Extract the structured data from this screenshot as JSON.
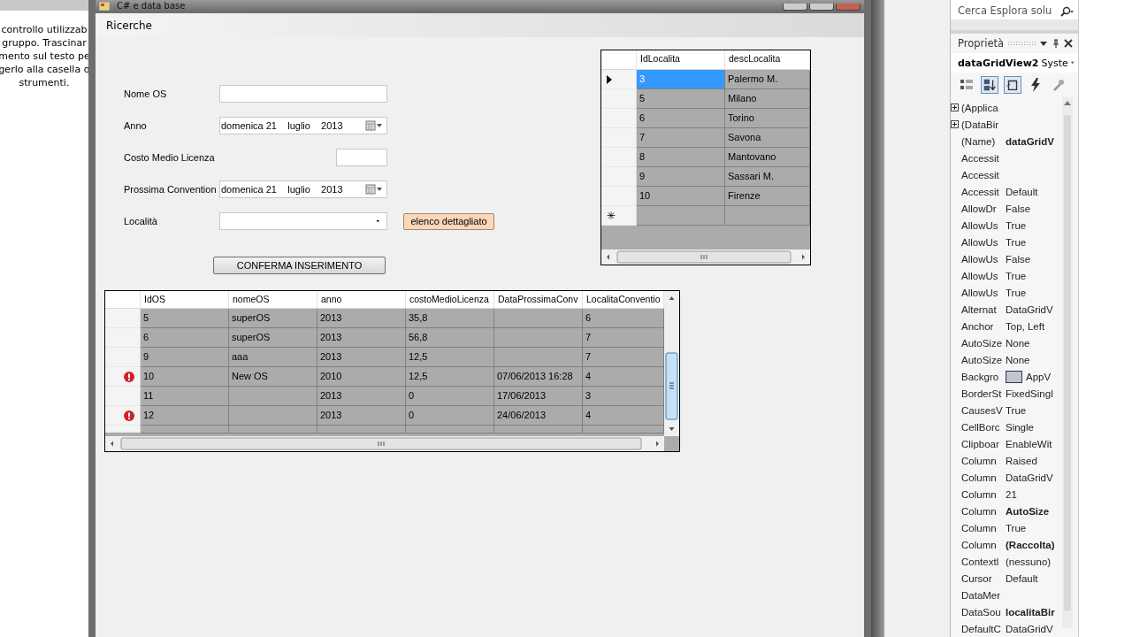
{
  "left_panel": {
    "lines": [
      "controllo utilizzab",
      "gruppo. Trascinar",
      "mento sul testo pe",
      "gerlo alla casella d",
      "strumenti."
    ]
  },
  "form_window": {
    "title": "C# e data base",
    "menu": [
      "Ricerche"
    ],
    "fields": [
      {
        "kind": "text",
        "label": "Nome OS"
      },
      {
        "kind": "date",
        "label": "Anno",
        "value": "domenica 21    luglio    2013"
      },
      {
        "kind": "short",
        "label": "Costo Medio Licenza"
      },
      {
        "kind": "date",
        "label": "Prossima Convention",
        "value": "domenica 21    luglio    2013"
      },
      {
        "kind": "combo",
        "label": "Località",
        "button": "elenco dettagliato"
      }
    ],
    "confirm_button": "CONFERMA INSERIMENTO",
    "localita_grid": {
      "columns": [
        "IdLocalita",
        "descLocalita"
      ],
      "rows": [
        {
          "selected": true,
          "cells": [
            "3",
            "Palermo M."
          ]
        },
        {
          "selected": false,
          "cells": [
            "5",
            "Milano"
          ]
        },
        {
          "selected": false,
          "cells": [
            "6",
            "Torino"
          ]
        },
        {
          "selected": false,
          "cells": [
            "7",
            "Savona"
          ]
        },
        {
          "selected": false,
          "cells": [
            "8",
            "Mantovano"
          ]
        },
        {
          "selected": false,
          "cells": [
            "9",
            "Sassari M."
          ]
        },
        {
          "selected": false,
          "cells": [
            "10",
            "Firenze"
          ]
        }
      ],
      "new_row_marker": "✳"
    },
    "os_grid": {
      "columns": [
        "IdOS",
        "nomeOS",
        "anno",
        "costoMedioLicenza",
        "DataProssimaConv",
        "LocalitaConventio"
      ],
      "rows": [
        {
          "error": false,
          "cells": [
            "5",
            "superOS",
            "2013",
            "35,8",
            "",
            "6"
          ]
        },
        {
          "error": false,
          "cells": [
            "6",
            "superOS",
            "2013",
            "56,8",
            "",
            "7"
          ]
        },
        {
          "error": false,
          "cells": [
            "9",
            "aaa",
            "2013",
            "12,5",
            "",
            "7"
          ]
        },
        {
          "error": true,
          "cells": [
            "10",
            "New OS",
            "2010",
            "12,5",
            "07/06/2013 16:28",
            "4"
          ]
        },
        {
          "error": false,
          "cells": [
            "11",
            "",
            "2013",
            "0",
            "17/06/2013",
            "3"
          ]
        },
        {
          "error": true,
          "cells": [
            "12",
            "",
            "2013",
            "0",
            "24/06/2013",
            "4"
          ]
        }
      ]
    }
  },
  "solution_search": {
    "placeholder": "Cerca Esplora solu"
  },
  "properties": {
    "title": "Proprietà",
    "object": "dataGridView2",
    "object_type": "Syste",
    "rows": [
      {
        "name": "(Applica",
        "expandable": true
      },
      {
        "name": "(DataBir",
        "expandable": true
      },
      {
        "name": "(Name)",
        "value": "dataGridV",
        "expandable": false,
        "bold": true
      },
      {
        "name": "Accessit",
        "expandable": false
      },
      {
        "name": "Accessit",
        "expandable": false
      },
      {
        "name": "Accessit",
        "value": "Default",
        "expandable": false,
        "bold": false
      },
      {
        "name": "AllowDr",
        "value": "False",
        "expandable": false,
        "bold": false
      },
      {
        "name": "AllowUs",
        "value": "True",
        "expandable": false,
        "bold": false
      },
      {
        "name": "AllowUs",
        "value": "True",
        "expandable": false,
        "bold": false
      },
      {
        "name": "AllowUs",
        "value": "False",
        "expandable": false,
        "bold": false
      },
      {
        "name": "AllowUs",
        "value": "True",
        "expandable": false,
        "bold": false
      },
      {
        "name": "AllowUs",
        "value": "True",
        "expandable": false,
        "bold": false
      },
      {
        "name": "Alternat",
        "value": "DataGridV",
        "expandable": false,
        "bold": false
      },
      {
        "name": "Anchor",
        "value": "Top, Left",
        "expandable": false,
        "bold": false
      },
      {
        "name": "AutoSize",
        "value": "None",
        "expandable": false,
        "bold": false
      },
      {
        "name": "AutoSize",
        "value": "None",
        "expandable": false,
        "bold": false
      },
      {
        "name": "Backgro",
        "value": "AppV",
        "kind": "color",
        "expandable": false,
        "bold": false
      },
      {
        "name": "BorderSt",
        "value": "FixedSingl",
        "expandable": false,
        "bold": false
      },
      {
        "name": "CausesV",
        "value": "True",
        "expandable": false,
        "bold": false
      },
      {
        "name": "CellBorc",
        "value": "Single",
        "expandable": false,
        "bold": false
      },
      {
        "name": "Clipboar",
        "value": "EnableWit",
        "expandable": false,
        "bold": false
      },
      {
        "name": "Column",
        "value": "Raised",
        "expandable": false,
        "bold": false
      },
      {
        "name": "Column",
        "value": "DataGridV",
        "expandable": false,
        "bold": false
      },
      {
        "name": "Column",
        "value": "21",
        "expandable": false,
        "bold": false
      },
      {
        "name": "Column",
        "value": "AutoSize",
        "expandable": false,
        "bold": true
      },
      {
        "name": "Column",
        "value": "True",
        "expandable": false,
        "bold": false
      },
      {
        "name": "Column",
        "value": "(Raccolta)",
        "expandable": false,
        "bold": true
      },
      {
        "name": "Contextl",
        "value": "(nessuno)",
        "expandable": false,
        "bold": false
      },
      {
        "name": "Cursor",
        "value": "Default",
        "expandable": false,
        "bold": false
      },
      {
        "name": "DataMer",
        "expandable": false
      },
      {
        "name": "DataSou",
        "value": "localitaBir",
        "expandable": false,
        "bold": true
      },
      {
        "name": "DefaultC",
        "value": "DataGridV",
        "expandable": false,
        "bold": false
      }
    ]
  }
}
